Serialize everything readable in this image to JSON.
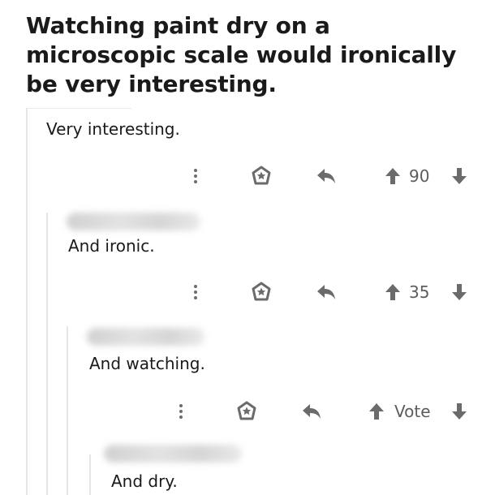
{
  "post": {
    "title": "Watching paint dry on a microscopic scale would ironically be very interesting."
  },
  "colors": {
    "icon": "#6b6b6b",
    "thread_line": "#e6e6e6",
    "text": "#1a1a1b"
  },
  "comments": [
    {
      "text": "Very interesting.",
      "score": "90"
    },
    {
      "text": "And ironic.",
      "score": "35"
    },
    {
      "text": "And watching.",
      "score": "Vote"
    },
    {
      "text": "And dry."
    }
  ],
  "icons": {
    "more": "more-options-icon",
    "award": "award-icon",
    "reply": "reply-icon",
    "upvote": "upvote-arrow-icon",
    "downvote": "downvote-arrow-icon"
  }
}
